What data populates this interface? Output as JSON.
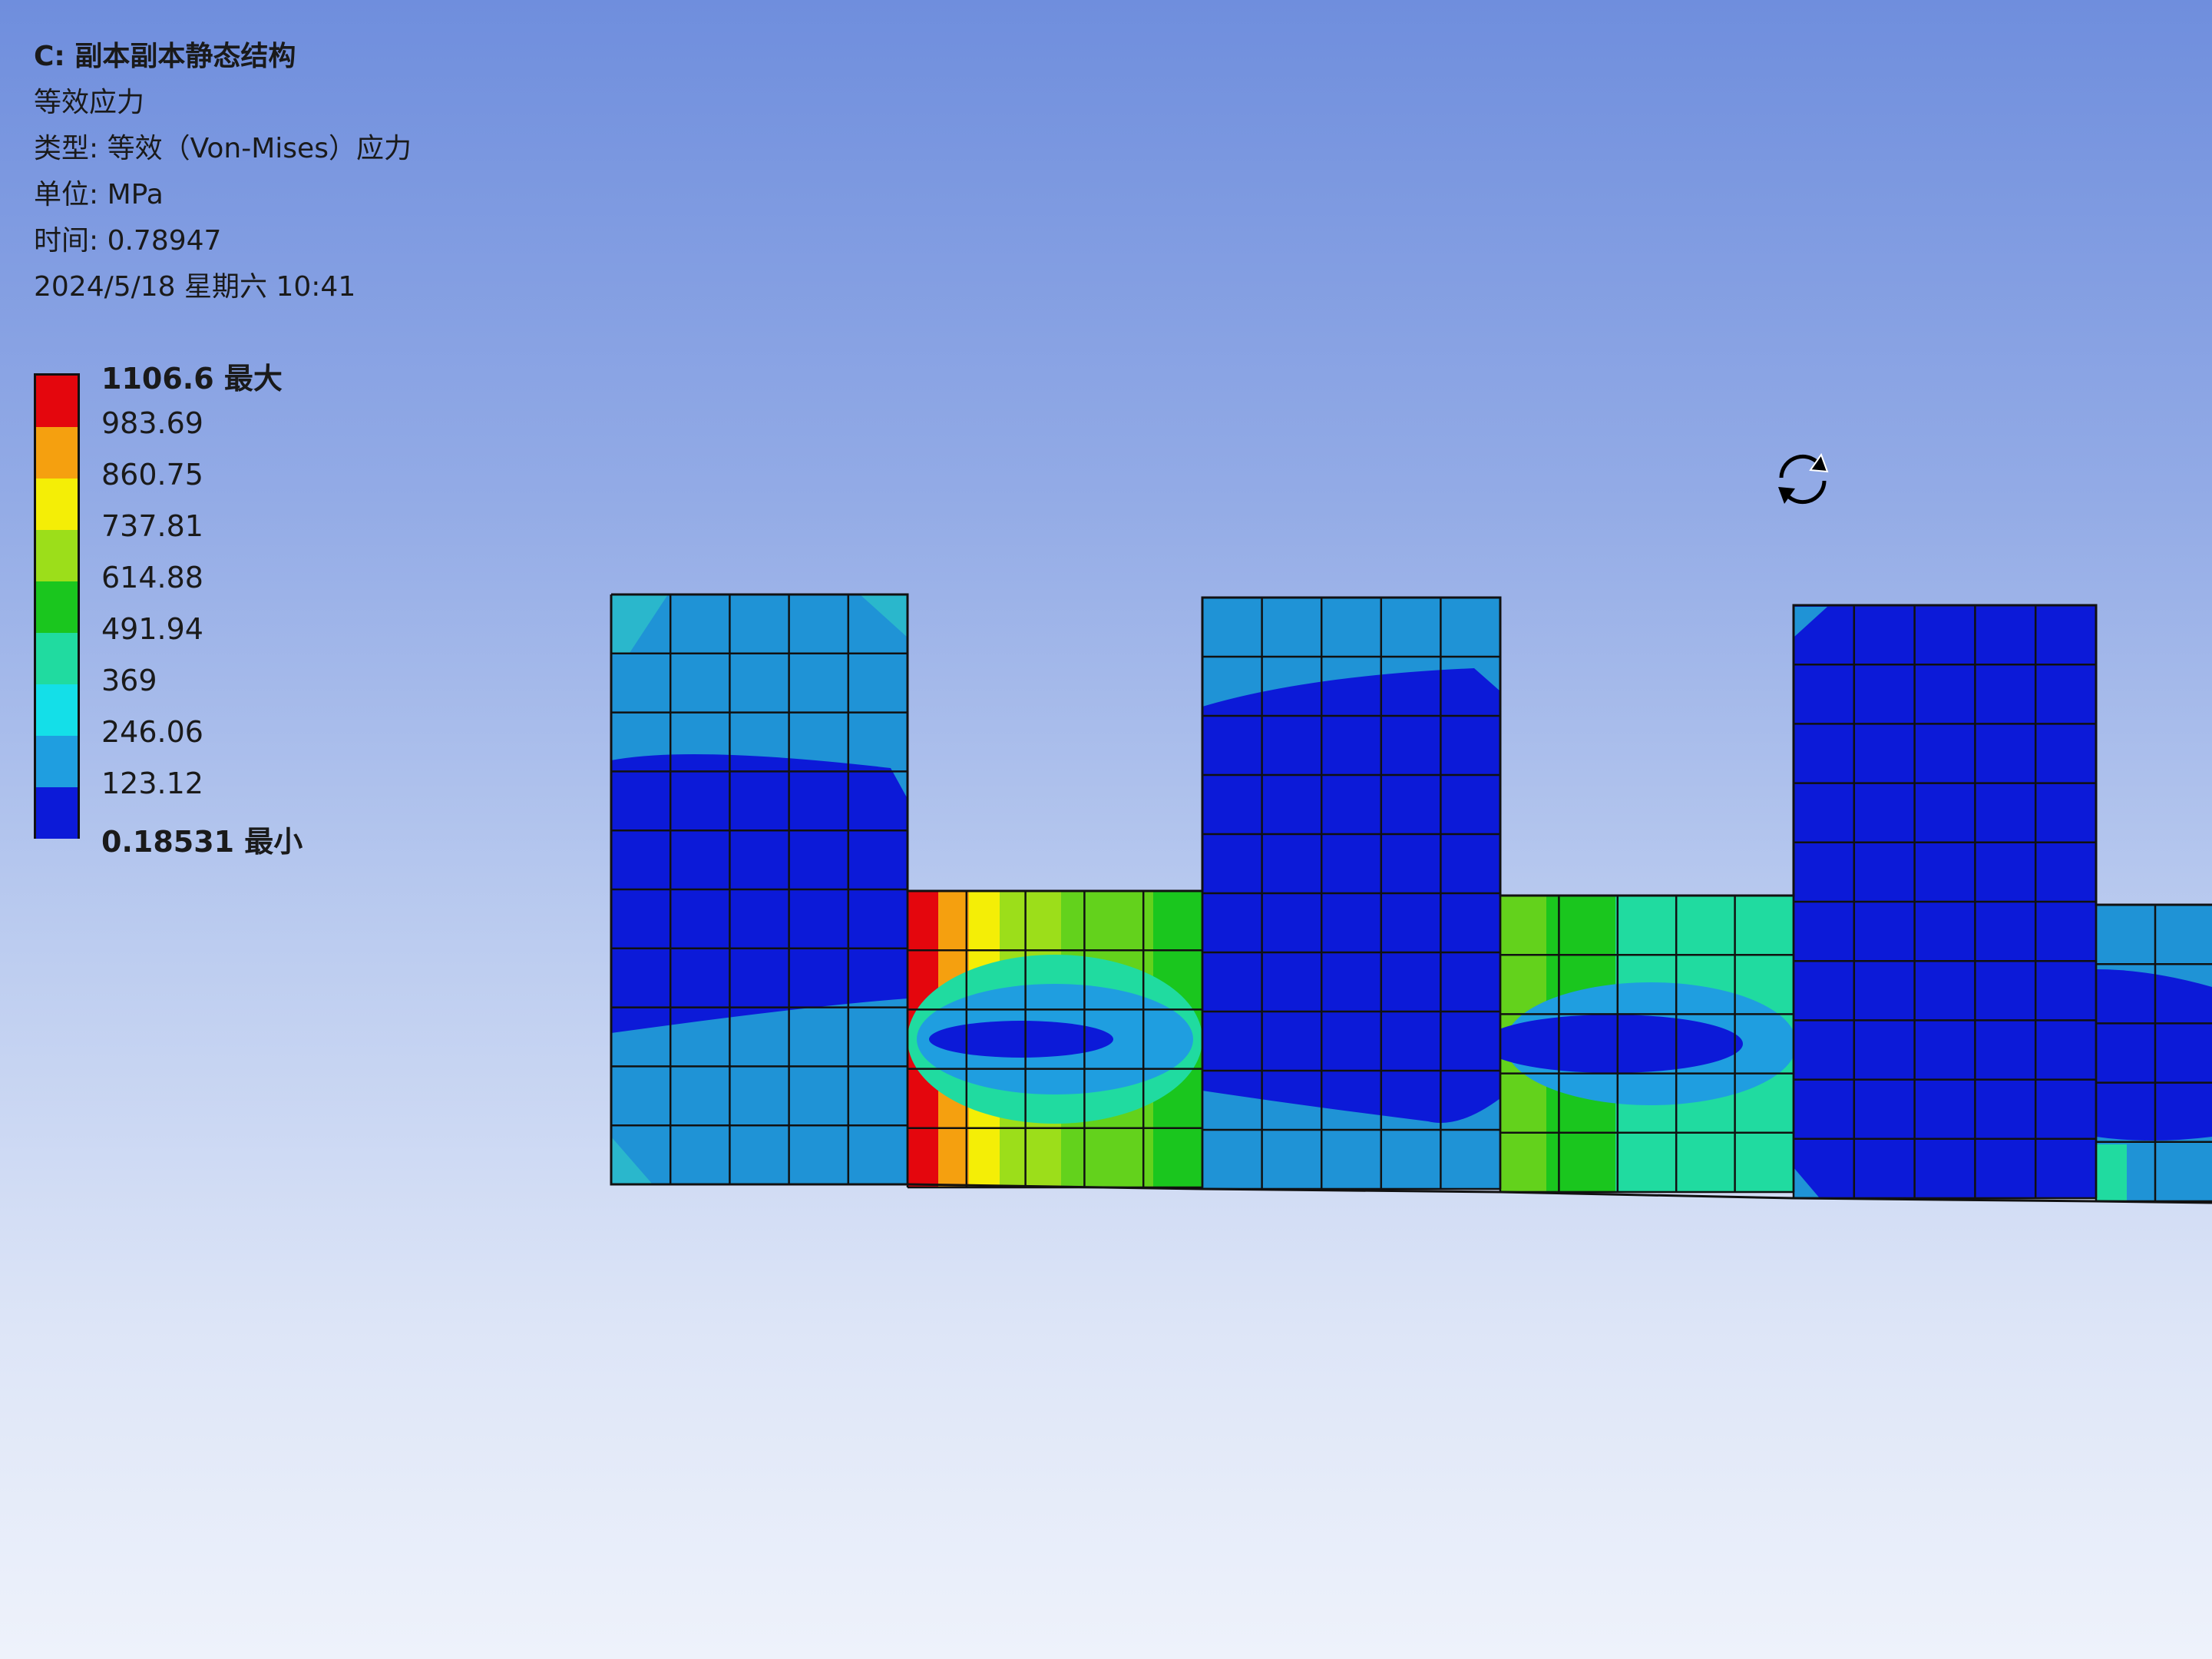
{
  "info": {
    "title": "C: 副本副本静态结构",
    "result": "等效应力",
    "type": "类型: 等效（Von-Mises）应力",
    "unit": "单位: MPa",
    "time": "时间: 0.78947",
    "datetime": "2024/5/18 星期六 10:41"
  },
  "legend": {
    "colors": [
      "#e4060d",
      "#f5a00f",
      "#f4ee06",
      "#9cde1a",
      "#1ac61e",
      "#20dba0",
      "#14dfe8",
      "#1f9ee0",
      "#0c1ad8"
    ],
    "labels": [
      {
        "text": "1106.6 最大",
        "bold": true
      },
      {
        "text": "983.69",
        "bold": false
      },
      {
        "text": "860.75",
        "bold": false
      },
      {
        "text": "737.81",
        "bold": false
      },
      {
        "text": "614.88",
        "bold": false
      },
      {
        "text": "491.94",
        "bold": false
      },
      {
        "text": "369",
        "bold": false
      },
      {
        "text": "246.06",
        "bold": false
      },
      {
        "text": "123.12",
        "bold": false
      },
      {
        "text": "0.18531 最小",
        "bold": true
      }
    ]
  },
  "viewport": {
    "cursor_icon": "rotate-icon"
  }
}
